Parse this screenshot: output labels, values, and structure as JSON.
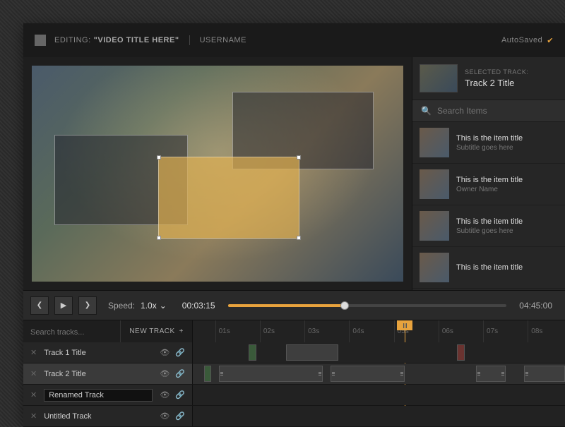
{
  "header": {
    "editing_label": "EDITING:",
    "video_title": "\"VIDEO TITLE HERE\"",
    "username": "USERNAME",
    "autosaved": "AutoSaved"
  },
  "sidebar": {
    "selected_label": "SELECTED TRACK:",
    "selected_title": "Track 2 Title",
    "search_placeholder": "Search Items",
    "items": [
      {
        "title": "This is the item title",
        "sub": "Subtitle goes here"
      },
      {
        "title": "This is the item title",
        "sub": "Owner Name"
      },
      {
        "title": "This is the item title",
        "sub": "Subtitle goes here"
      },
      {
        "title": "This is the item title",
        "sub": ""
      }
    ]
  },
  "controls": {
    "speed_label": "Speed:",
    "speed_value": "1.0x",
    "current_time": "00:03:15",
    "duration": "04:45:00"
  },
  "timeline": {
    "search_placeholder": "Search tracks...",
    "new_track_label": "NEW TRACK",
    "ruler": [
      "01s",
      "02s",
      "03s",
      "04s",
      "05s",
      "06s",
      "07s",
      "08s"
    ],
    "tracks": [
      {
        "name": "Track 1 Title"
      },
      {
        "name": "Track 2 Title"
      },
      {
        "name": "Renamed Track"
      },
      {
        "name": "Untitled Track"
      }
    ]
  }
}
